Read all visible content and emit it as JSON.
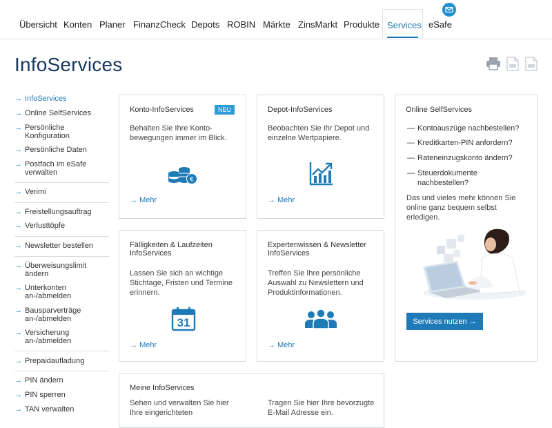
{
  "nav": {
    "items": [
      "Übersicht",
      "Konten",
      "Planer",
      "FinanzCheck",
      "Depots",
      "ROBIN",
      "Märkte",
      "ZinsMarkt",
      "Produkte",
      "Services",
      "eSafe"
    ],
    "active": "Services"
  },
  "page": {
    "title": "InfoServices"
  },
  "sidebar": {
    "items": [
      "InfoServices",
      "Online SelfServices",
      "Persönliche Konfiguration",
      "Persönliche Daten",
      "Postfach im eSafe verwalten",
      "Verimi",
      "Freistellungsauftrag",
      "Verlusttöpfe",
      "Newsletter bestellen",
      "Überweisungslimit ändern",
      "Unterkonten an-/abmelden",
      "Bausparverträge an-/abmelden",
      "Versicherung an-/abmelden",
      "Prepaidaufladung",
      "PIN ändern",
      "PIN sperren",
      "TAN verwalten"
    ]
  },
  "cards": {
    "konto": {
      "title": "Konto-InfoServices",
      "badge": "NEU",
      "text": "Behalten Sie Ihre Konto-\nbewegungen immer im Blick.",
      "more": "Mehr",
      "icon": "coins-euro-icon"
    },
    "depot": {
      "title": "Depot-InfoServices",
      "text": "Beobachten Sie Ihr Depot und\neinzelne Wertpapiere.",
      "more": "Mehr",
      "icon": "chart-up-icon"
    },
    "faellig": {
      "title": "Fälligkeiten & Laufzeiten\nInfoServices",
      "text": "Lassen Sie sich an wichtige\nStichtage, Fristen und Termine\nerinnern.",
      "more": "Mehr",
      "icon": "calendar-icon",
      "calendar_day": "31"
    },
    "experten": {
      "title": "Expertenwissen & Newsletter\nInfoServices",
      "text": "Treffen Sie Ihre persönliche\nAuswahl zu Newslettern und\nProduktinformationen.",
      "more": "Mehr",
      "icon": "group-icon"
    },
    "meine": {
      "title": "Meine InfoServices",
      "text_left": "Sehen und verwalten Sie hier\nIhre eingerichteten",
      "text_right": "Tragen Sie hier Ihre bevorzugte\nE-Mail Adresse ein."
    }
  },
  "online_selfservices": {
    "title": "Online SelfServices",
    "items": [
      "Kontoauszüge nachbestellen?",
      "Kreditkarten-PIN anfordern?",
      "Rateneinzugskonto ändern?",
      "Steuerdokumente\nnachbestellen?"
    ],
    "text": "Das und vieles mehr können Sie\nonline ganz bequem selbst\nerledigen.",
    "button": "Services nutzen"
  },
  "colors": {
    "accent": "#1f7ab8",
    "title": "#15365e",
    "badge": "#2e9bd6"
  }
}
